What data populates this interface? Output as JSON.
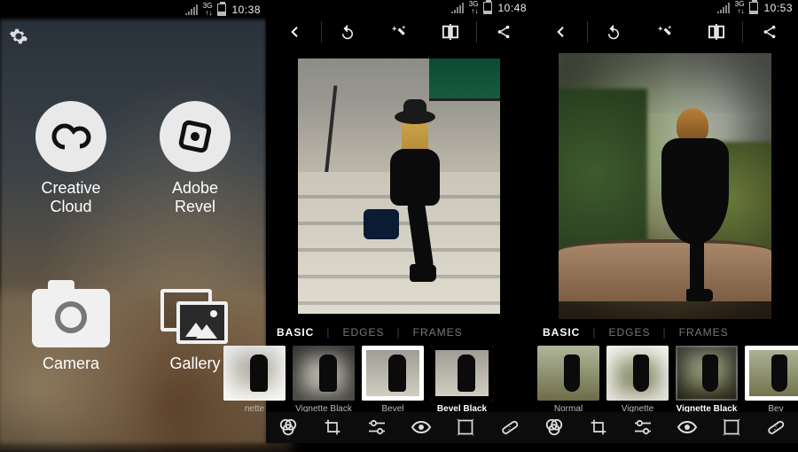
{
  "status": {
    "net": "3G",
    "time1": "10:38",
    "time2": "10:48",
    "time3": "10:53"
  },
  "home": {
    "items": [
      {
        "label": "Creative\nCloud"
      },
      {
        "label": "Adobe\nRevel"
      },
      {
        "label": "Camera"
      },
      {
        "label": "Gallery"
      }
    ]
  },
  "editor": {
    "tabs": [
      {
        "label": "BASIC",
        "active": true
      },
      {
        "label": "EDGES",
        "active": false
      },
      {
        "label": "FRAMES",
        "active": false
      }
    ]
  },
  "strip2": {
    "offset_label": "nette",
    "items": [
      {
        "label": "Vignette Black",
        "selected": false,
        "style": "vign"
      },
      {
        "label": "Bevel",
        "selected": false,
        "style": "bevel"
      },
      {
        "label": "Bevel Black",
        "selected": true,
        "style": "bevel-b"
      }
    ]
  },
  "strip3": {
    "items": [
      {
        "label": "Normal",
        "selected": false,
        "style": ""
      },
      {
        "label": "Vignette",
        "selected": false,
        "style": "vign-w"
      },
      {
        "label": "Vignette Black",
        "selected": true,
        "style": "vign"
      }
    ],
    "trail_label": "Bev"
  }
}
